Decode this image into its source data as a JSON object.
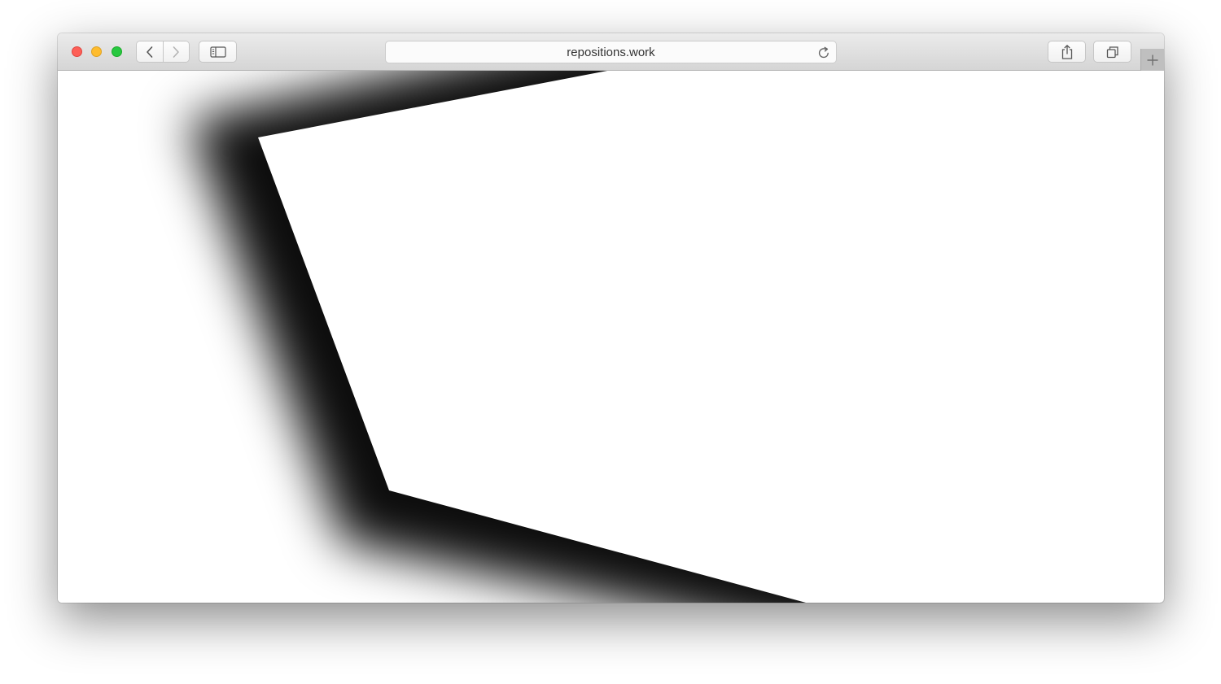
{
  "window": {
    "traffic_lights": {
      "close_color": "#fd5f57",
      "minimize_color": "#febc2e",
      "zoom_color": "#28c840"
    }
  },
  "toolbar": {
    "back_icon": "chevron-left-icon",
    "forward_icon": "chevron-right-icon",
    "sidebar_icon": "sidebar-icon",
    "share_icon": "share-icon",
    "tabs_icon": "tabs-overview-icon",
    "new_tab_icon": "plus-icon"
  },
  "address_bar": {
    "url": "repositions.work",
    "reload_icon": "reload-icon"
  },
  "page": {
    "background_color": "#ffffff",
    "shadow_color": "#000000"
  }
}
